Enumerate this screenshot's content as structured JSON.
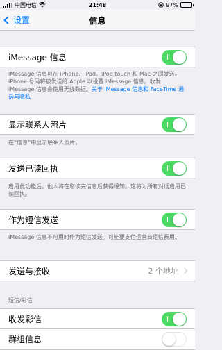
{
  "status_bar": {
    "carrier": "中国电信",
    "time": "21:48",
    "battery_percent": "97%",
    "battery_level": 0.97
  },
  "nav": {
    "back_label": "设置",
    "title": "信息"
  },
  "imessage": {
    "label": "iMessage 信息",
    "enabled": true,
    "footnote": "iMessage 信息可在 iPhone、iPad、iPod touch 和 Mac 之间发送。iPhone 号码将被发送给 Apple 以设置 iMessage 信息。收发 iMessage 信息会使用无线数据。",
    "footnote_link": "关于 iMessage 信息和 FaceTime 通话与隐私"
  },
  "contact_photos": {
    "label": "显示联系人照片",
    "enabled": true,
    "footnote": "在“信息”中显示联系人照片。"
  },
  "read_receipts": {
    "label": "发送已读回执",
    "enabled": true,
    "footnote": "启用此功能后，他人将在您读完信息后获得通知。这将为所有对话启用已读回执。"
  },
  "send_as_sms": {
    "label": "作为短信发送",
    "enabled": true,
    "footnote": "iMessage 信息不可用时作为短信发送。可能要支付运营商短信费用。"
  },
  "send_receive": {
    "label": "发送与接收",
    "value": "2 个地址"
  },
  "sms_section": {
    "header": "短信/彩信"
  },
  "mms": {
    "label": "收发彩信",
    "enabled": true
  },
  "group": {
    "label": "群组信息",
    "enabled": false
  }
}
